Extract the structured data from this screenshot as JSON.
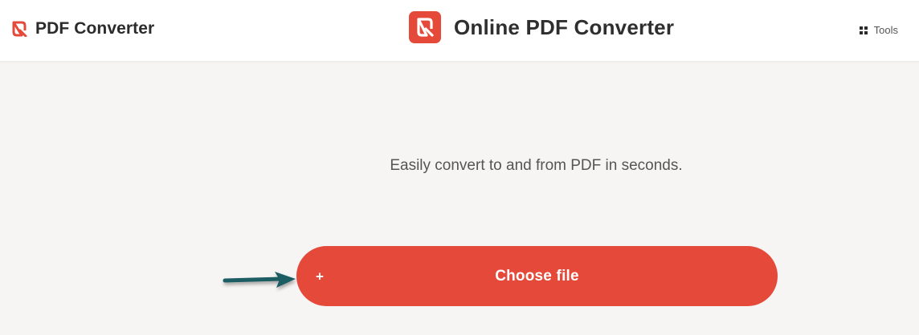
{
  "header": {
    "brand_name": "PDF Converter",
    "title": "Online PDF Converter",
    "tools_label": "Tools"
  },
  "main": {
    "tagline": "Easily convert to and from PDF in seconds.",
    "choose_button_label": "Choose file",
    "choose_button_icon_glyph": "+"
  },
  "icons": {
    "brand_logo": "pdf-converter-logo-icon",
    "title_logo": "pdf-converter-logo-icon",
    "tools": "grid-icon",
    "plus": "plus-icon",
    "annotation_arrow": "arrow-right-icon"
  },
  "colors": {
    "accent": "#e5493a",
    "background": "#f7f5f3",
    "header_background": "#ffffff",
    "arrow": "#1d5b63"
  }
}
